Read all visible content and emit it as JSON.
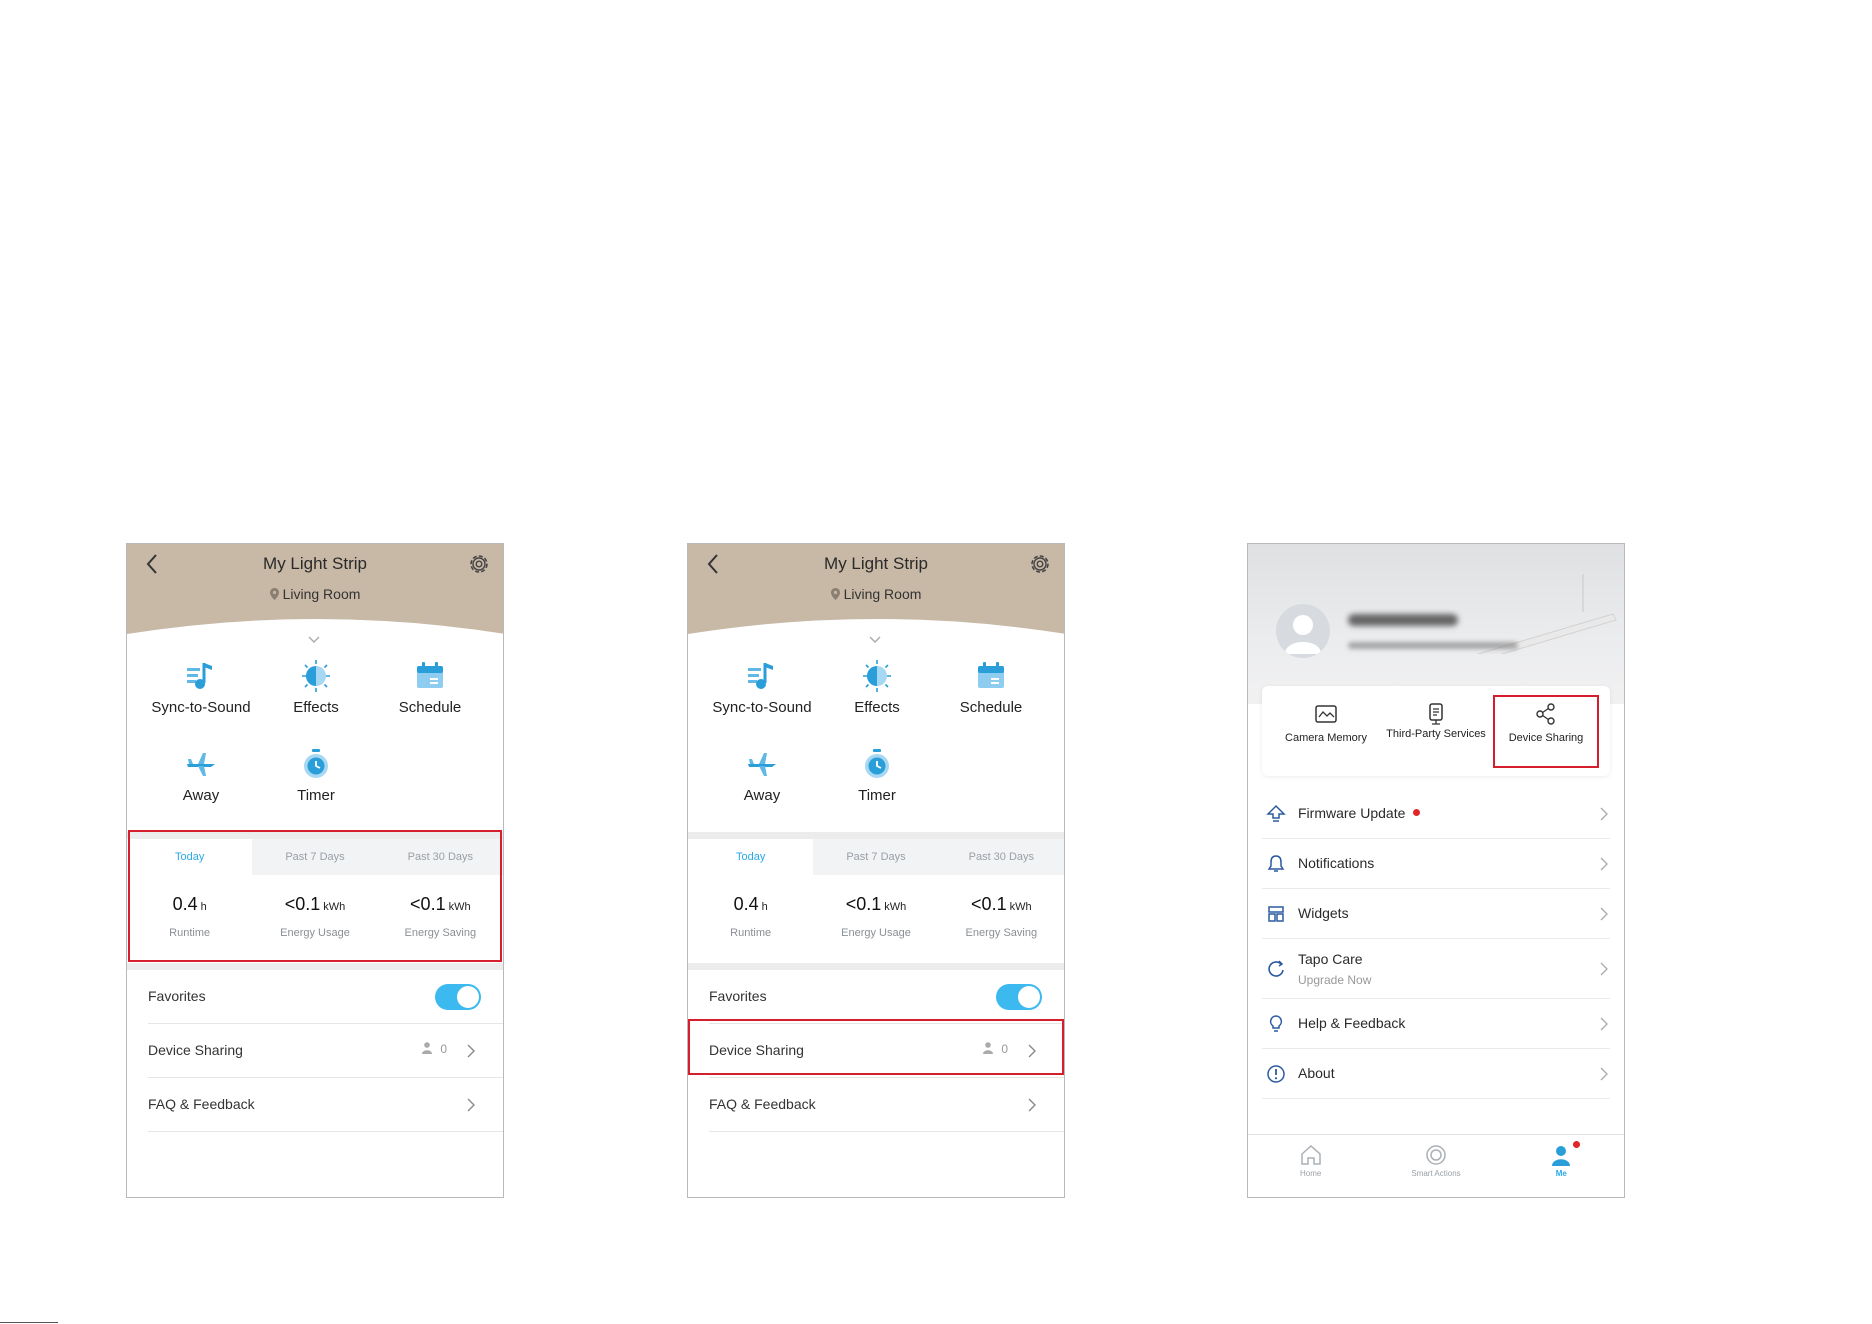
{
  "device": {
    "title": "My Light Strip",
    "room": "Living Room",
    "features": [
      {
        "label": "Sync-to-Sound",
        "icon": "music-note-icon"
      },
      {
        "label": "Effects",
        "icon": "effects-icon"
      },
      {
        "label": "Schedule",
        "icon": "calendar-icon"
      },
      {
        "label": "Away",
        "icon": "airplane-icon"
      },
      {
        "label": "Timer",
        "icon": "stopwatch-icon"
      }
    ],
    "stats_tabs": [
      "Today",
      "Past 7 Days",
      "Past 30 Days"
    ],
    "active_tab": "Today",
    "stats": [
      {
        "value": "0.4",
        "unit": "h",
        "label": "Runtime"
      },
      {
        "value": "<0.1",
        "unit": "kWh",
        "label": "Energy Usage"
      },
      {
        "value": "<0.1",
        "unit": "kWh",
        "label": "Energy Saving"
      }
    ],
    "rows": {
      "favorites": "Favorites",
      "favorites_on": true,
      "device_sharing": "Device Sharing",
      "share_count": "0",
      "faq": "FAQ & Feedback"
    }
  },
  "me": {
    "quick_actions": [
      {
        "label": "Camera Memory",
        "icon": "camera-memory-icon"
      },
      {
        "label": "Third-Party Services",
        "icon": "third-party-icon"
      },
      {
        "label": "Device Sharing",
        "icon": "share-icon"
      }
    ],
    "menu": [
      {
        "label": "Firmware Update",
        "icon": "firmware-update-icon",
        "badge": true
      },
      {
        "label": "Notifications",
        "icon": "bell-icon"
      },
      {
        "label": "Widgets",
        "icon": "widgets-icon"
      },
      {
        "label": "Tapo Care",
        "sub": "Upgrade Now",
        "icon": "tapo-care-icon"
      },
      {
        "label": "Help & Feedback",
        "icon": "lightbulb-icon"
      },
      {
        "label": "About",
        "icon": "info-icon"
      }
    ],
    "tabbar": [
      {
        "label": "Home",
        "icon": "home-icon"
      },
      {
        "label": "Smart Actions",
        "icon": "smart-actions-icon"
      },
      {
        "label": "Me",
        "icon": "me-icon",
        "active": true
      }
    ]
  },
  "colors": {
    "header_beige": "#c8b8a6",
    "accent_blue": "#29a9e6",
    "highlight_red": "#d61f2c"
  }
}
